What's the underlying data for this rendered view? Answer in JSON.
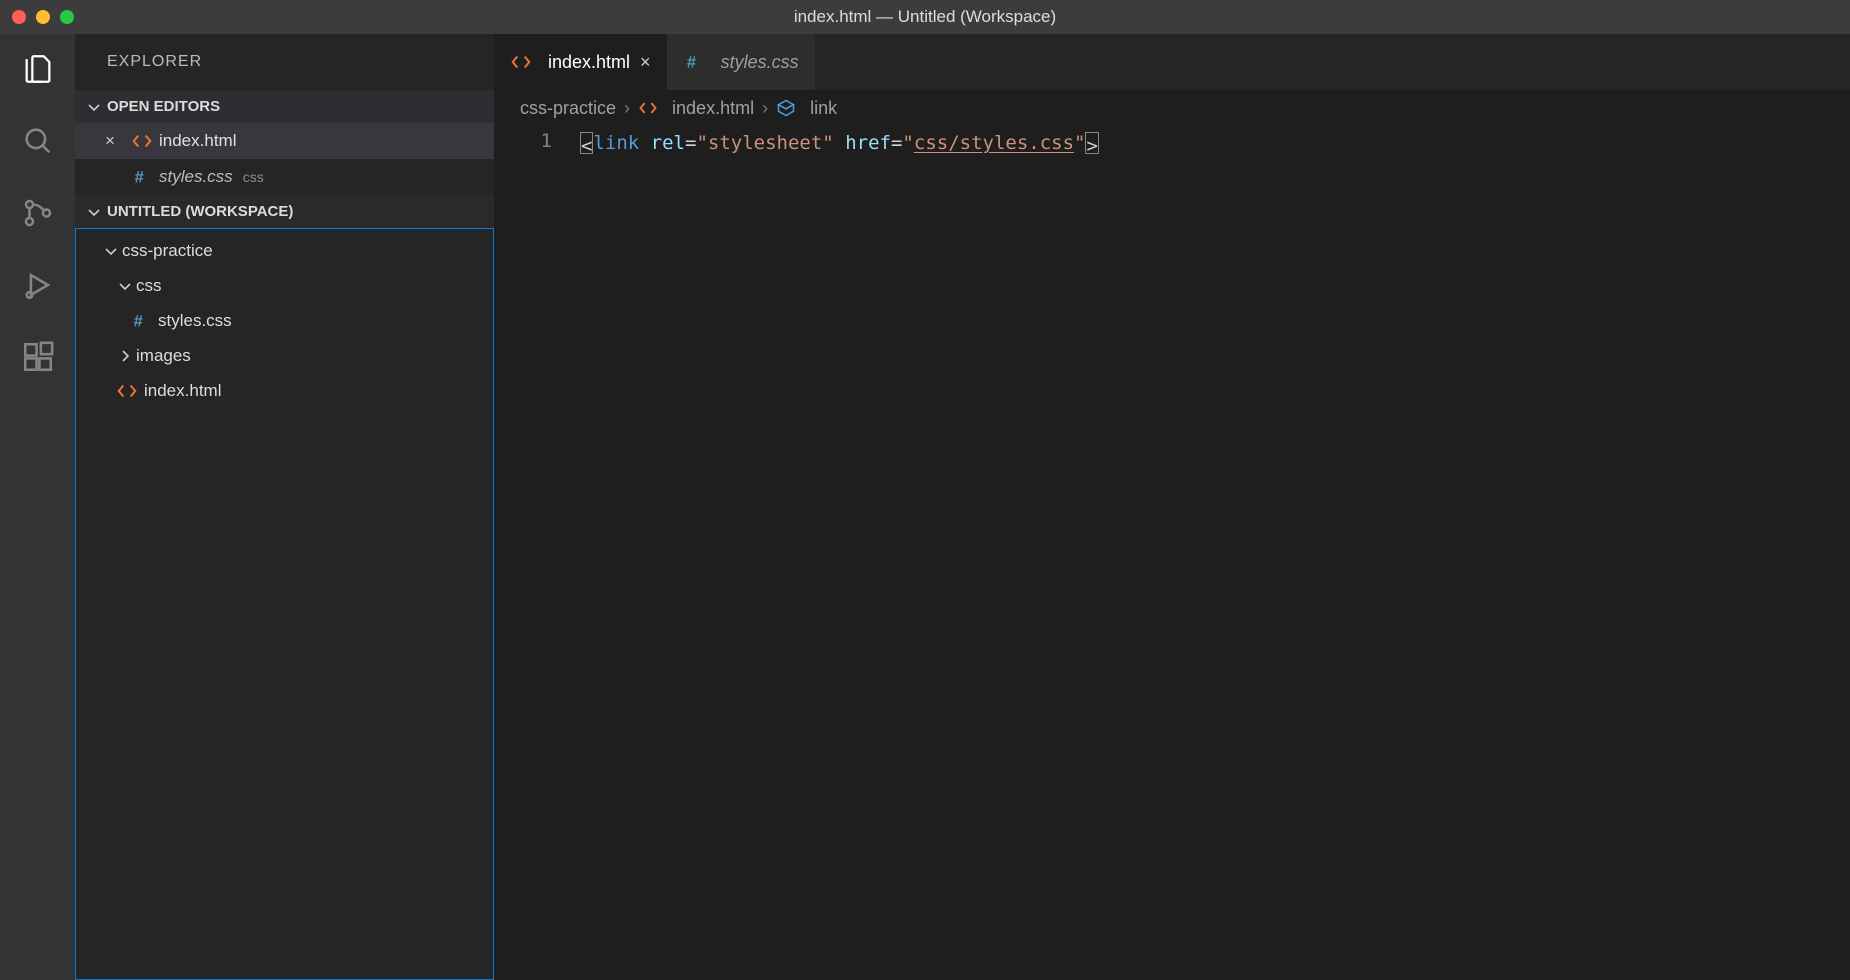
{
  "window": {
    "title": "index.html — Untitled (Workspace)"
  },
  "sidebar": {
    "title": "EXPLORER",
    "open_editors_label": "OPEN EDITORS",
    "open_editors": [
      {
        "name": "index.html",
        "icon": "html",
        "active": true,
        "close_glyph": "×"
      },
      {
        "name": "styles.css",
        "icon": "css",
        "hint": "css",
        "italic": true
      }
    ],
    "workspace_label": "UNTITLED (WORKSPACE)",
    "tree": [
      {
        "name": "css-practice",
        "kind": "folder",
        "expanded": true,
        "indent": 0
      },
      {
        "name": "css",
        "kind": "folder",
        "expanded": true,
        "indent": 1
      },
      {
        "name": "styles.css",
        "kind": "file",
        "icon": "css",
        "indent": 2
      },
      {
        "name": "images",
        "kind": "folder",
        "expanded": false,
        "indent": 1
      },
      {
        "name": "index.html",
        "kind": "file",
        "icon": "html",
        "indent": 1
      }
    ]
  },
  "tabs": [
    {
      "name": "index.html",
      "icon": "html",
      "active": true,
      "close_glyph": "×"
    },
    {
      "name": "styles.css",
      "icon": "css",
      "active": false
    }
  ],
  "breadcrumb": {
    "parts": [
      {
        "text": "css-practice"
      },
      {
        "text": "index.html",
        "icon": "html"
      },
      {
        "text": "link",
        "icon": "symbol"
      }
    ],
    "sep": "›"
  },
  "code": {
    "line_number": "1",
    "tokens": {
      "open_bracket": "<",
      "tag": "link",
      "sp1": " ",
      "attr_rel": "rel",
      "eq": "=",
      "q": "\"",
      "val_rel": "stylesheet",
      "sp2": " ",
      "attr_href": "href",
      "val_href": "css/styles.css",
      "close_bracket": ">"
    }
  }
}
